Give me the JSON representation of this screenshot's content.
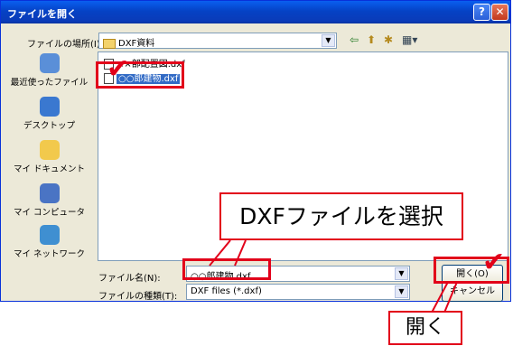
{
  "window": {
    "title": "ファイルを開く",
    "help": "?",
    "close": "✕"
  },
  "location": {
    "label": "ファイルの場所(I):",
    "value": "DXF資料"
  },
  "toolbar": {
    "back": "⇦",
    "up": "⬆",
    "new_folder": "✱",
    "views": "▦▾"
  },
  "places": [
    {
      "label": "最近使ったファイル",
      "icon": "recent-documents-icon",
      "color": "#5a8fd8"
    },
    {
      "label": "デスクトップ",
      "icon": "desktop-icon",
      "color": "#3a78d0"
    },
    {
      "label": "マイ ドキュメント",
      "icon": "my-documents-icon",
      "color": "#f2c94c"
    },
    {
      "label": "マイ コンピュータ",
      "icon": "my-computer-icon",
      "color": "#4a74c4"
    },
    {
      "label": "マイ ネットワーク",
      "icon": "my-network-icon",
      "color": "#3f8fd1"
    }
  ],
  "files": [
    {
      "name": "××部配置図.dxf",
      "selected": false
    },
    {
      "name": "○○郎建物.dxf",
      "selected": true
    }
  ],
  "filename": {
    "label": "ファイル名(N):",
    "value": "○○郎建物.dxf"
  },
  "filetype": {
    "label": "ファイルの種類(T):",
    "value": "DXF files (*.dxf)"
  },
  "buttons": {
    "open": "開く(O)",
    "cancel": "キャンセル"
  },
  "annotations": {
    "select_callout": "DXFファイルを選択",
    "open_callout": "開く",
    "check": "✔"
  },
  "colors": {
    "title_bar": "#0542c5",
    "highlight": "#e2001a",
    "selection": "#316ac5"
  }
}
